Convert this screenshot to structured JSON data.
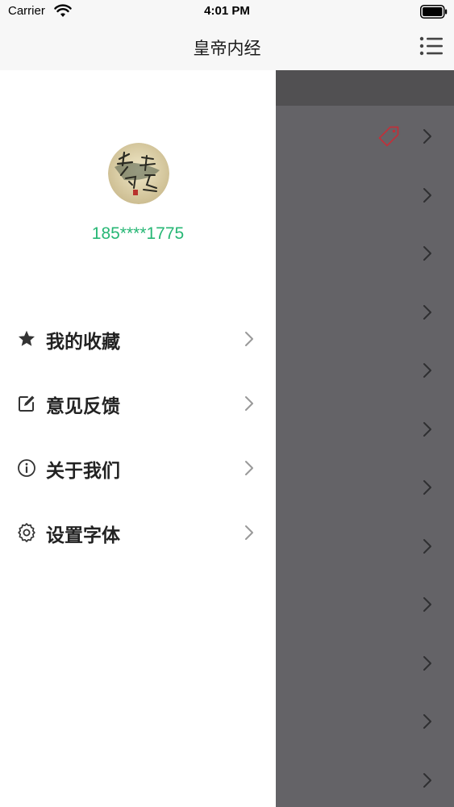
{
  "status_bar": {
    "carrier": "Carrier",
    "time": "4:01 PM"
  },
  "nav": {
    "title": "皇帝内经",
    "menu_icon": "list-menu-icon"
  },
  "profile": {
    "avatar_icon": "book-cover-avatar",
    "phone": "185****1775",
    "phone_color": "#27b775"
  },
  "menu": {
    "items": [
      {
        "label": "我的收藏",
        "icon": "star-icon"
      },
      {
        "label": "意见反馈",
        "icon": "edit-icon"
      },
      {
        "label": "关于我们",
        "icon": "info-icon"
      },
      {
        "label": "设置字体",
        "icon": "gear-icon"
      }
    ]
  },
  "list": {
    "row_count": 12,
    "first_row_icon": "tag-icon",
    "tag_color": "#c0303a"
  }
}
